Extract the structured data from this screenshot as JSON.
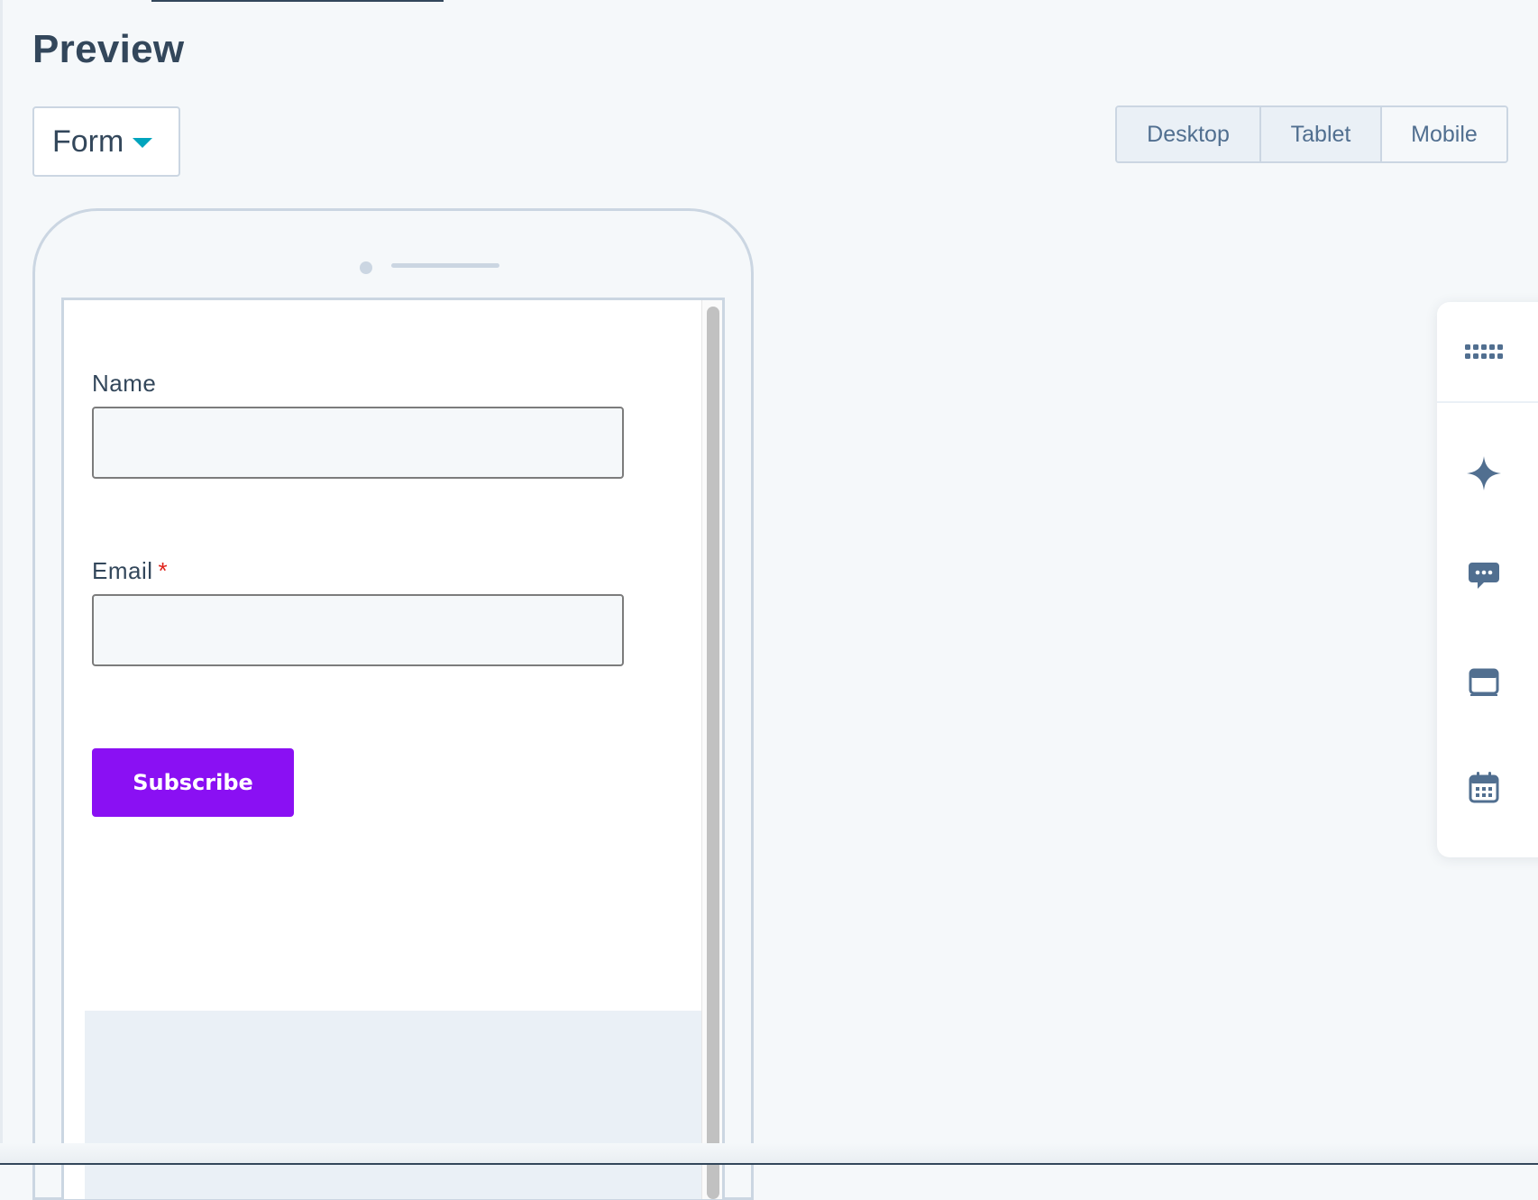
{
  "page": {
    "title": "Preview"
  },
  "form_selector": {
    "label": "Form"
  },
  "device_toggle": {
    "desktop": "Desktop",
    "tablet": "Tablet",
    "mobile": "Mobile"
  },
  "form": {
    "fields": [
      {
        "label": "Name",
        "value": "",
        "required": false
      },
      {
        "label": "Email",
        "value": "",
        "required": true,
        "required_mark": "*"
      }
    ],
    "submit_label": "Subscribe"
  },
  "toolbar": {
    "icons": [
      "grid-icon",
      "sparkle-icon",
      "chat-icon",
      "window-icon",
      "calendar-icon"
    ]
  },
  "colors": {
    "text": "#33475b",
    "accent": "#00a4bd",
    "button": "#8a10f3",
    "required": "#e0221a",
    "icon": "#516f90"
  }
}
